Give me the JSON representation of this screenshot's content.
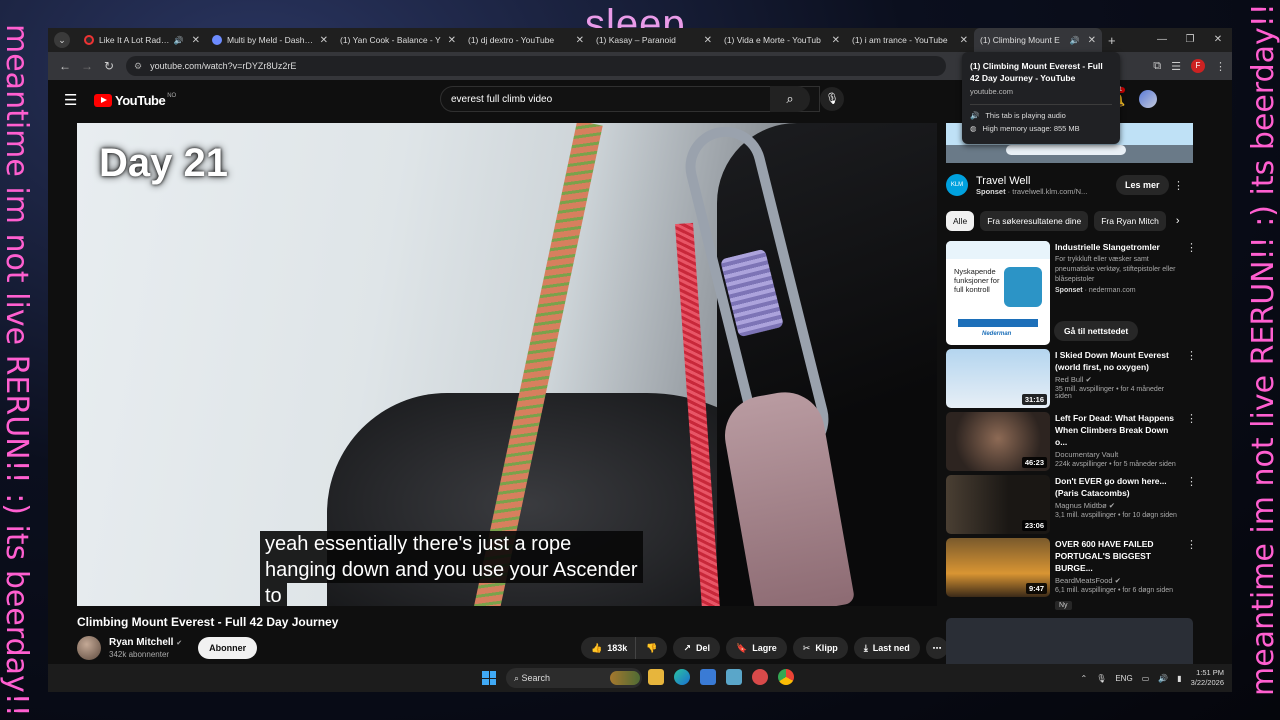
{
  "overlays": {
    "top": "sleep",
    "left": "meantime im not live RERUN!! :) its beerday!!",
    "right": "meantime im not live RERUN!! :) its beerday!!"
  },
  "tabs": [
    {
      "title": "Like It A Lot Radio – T",
      "favicon": "radio",
      "audio": true
    },
    {
      "title": "Multi by Meld - Dashboar",
      "favicon": "meld",
      "audio": false
    },
    {
      "title": "(1) Yan Cook - Balance - Y",
      "favicon": "youtube",
      "audio": false
    },
    {
      "title": "(1) dj dextro - YouTube",
      "favicon": "youtube",
      "audio": false
    },
    {
      "title": "(1) Kasay – Paranoid",
      "favicon": "youtube",
      "audio": false
    },
    {
      "title": "(1) Vida e Morte - YouTub",
      "favicon": "youtube",
      "audio": false
    },
    {
      "title": "(1) i am trance - YouTube",
      "favicon": "youtube",
      "audio": false
    },
    {
      "title": "(1) Climbing Mount E",
      "favicon": "youtube",
      "audio": true,
      "active": true
    }
  ],
  "url": "youtube.com/watch?v=rDYZr8Uz2rE",
  "tooltip": {
    "title": "(1) Climbing Mount Everest - Full 42 Day Journey - YouTube",
    "domain": "youtube.com",
    "audio": "This tab is playing audio",
    "memory": "High memory usage: 855 MB"
  },
  "yt": {
    "logo": "YouTube",
    "country": "NO",
    "search": "everest full climb video",
    "create_fragment": "ett",
    "notifications": "1",
    "video": {
      "day_label": "Day 21",
      "caption_lines": [
        "yeah essentially there's just a rope",
        "hanging down and you use your Ascender",
        "to"
      ],
      "title": "Climbing Mount Everest - Full 42 Day Journey",
      "channel": "Ryan Mitchell",
      "subs": "342k abonnenter",
      "subscribe": "Abonner",
      "likes": "183k",
      "share": "Del",
      "save": "Lagre",
      "clip": "Klipp",
      "download": "Last ned"
    },
    "sidebar": {
      "ad": {
        "title": "Travel Well",
        "sponsor_label": "Sponset",
        "sponsor_url": "travelwell.klm.com/N...",
        "logo_text": "KLM",
        "button": "Les mer"
      },
      "chips": [
        "Alle",
        "Fra søkeresultatene dine",
        "Fra Ryan Mitch"
      ],
      "ad2": {
        "title": "Industrielle Slangetromler",
        "desc": "For trykkluft eller væsker samt pneumatiske verktøy, stiftepistoler eller blåsepistoler",
        "sponsor_label": "Sponset",
        "sponsor_url": "nederman.com",
        "image_text": "Nyskapende funksjoner for full kontroll",
        "brand": "Nederman",
        "button": "Gå til nettstedet"
      },
      "videos": [
        {
          "title": "I Skied Down Mount Everest (world first, no oxygen)",
          "channel": "Red Bull",
          "stats": "35 mill. avspillinger • for 4 måneder siden",
          "duration": "31:16"
        },
        {
          "title": "Left For Dead: What Happens When Climbers Break Down o...",
          "channel": "Documentary Vault",
          "stats": "224k avspillinger • for 5 måneder siden",
          "duration": "46:23"
        },
        {
          "title": "Don't EVER go down here... (Paris Catacombs)",
          "channel": "Magnus Midtbø",
          "stats": "3,1 mill. avspillinger • for 10 døgn siden",
          "duration": "23:06"
        },
        {
          "title": "OVER 600 HAVE FAILED PORTUGAL'S BIGGEST BURGE...",
          "channel": "BeardMeatsFood",
          "stats": "6,1 mill. avspillinger • for 6 døgn siden",
          "duration": "9:47",
          "badge": "Ny"
        }
      ]
    }
  },
  "taskbar": {
    "search": "Search",
    "lang": "ENG",
    "time": "1:51 PM",
    "date": "3/22/2026"
  }
}
